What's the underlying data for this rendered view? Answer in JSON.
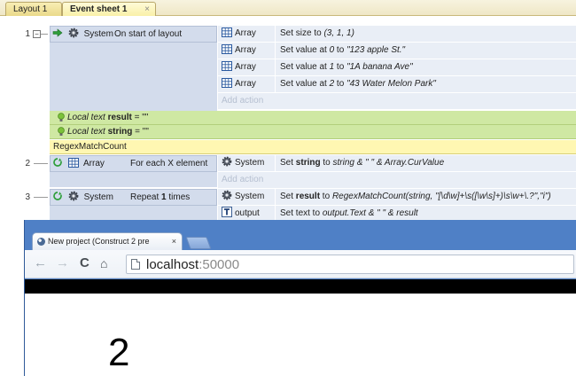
{
  "tabs": [
    {
      "label": "Layout 1"
    },
    {
      "label": "Event sheet 1",
      "close": "×"
    }
  ],
  "colors": {
    "condition_bg": "#d3dcec",
    "action_bg": "#e9eef6",
    "local_var_bg": "#cfe8a3",
    "comment_bg": "#fff7b2",
    "browser_frame": "#4f80c6"
  },
  "events": [
    {
      "number": "1",
      "condition": {
        "object": "System",
        "object_icon": "gear-icon",
        "text": "On start of layout"
      },
      "actions": [
        {
          "object": "Array",
          "icon": "grid-icon",
          "parts": [
            "Set size to ",
            "(3, 1, 1)"
          ]
        },
        {
          "object": "Array",
          "icon": "grid-icon",
          "parts": [
            "Set value at ",
            "0",
            " to ",
            "\"123 apple St.\""
          ]
        },
        {
          "object": "Array",
          "icon": "grid-icon",
          "parts": [
            "Set value at ",
            "1",
            " to ",
            "\"1A banana Ave\""
          ]
        },
        {
          "object": "Array",
          "icon": "grid-icon",
          "parts": [
            "Set value at ",
            "2",
            " to ",
            "\"43 Water Melon Park\""
          ]
        }
      ],
      "add_action": "Add action"
    },
    {
      "number": "2",
      "condition": {
        "object": "Array",
        "object_icon": "grid-icon",
        "text": "For each X element"
      },
      "actions": [
        {
          "object": "System",
          "icon": "gear-icon",
          "parts": [
            "Set ",
            "string",
            " to ",
            "string & \"  \" & Array.CurValue"
          ]
        }
      ],
      "add_action": "Add action"
    },
    {
      "number": "3",
      "condition": {
        "object": "System",
        "object_icon": "gear-icon",
        "text_prefix": "Repeat ",
        "text_bold": "1",
        "text_suffix": " times"
      },
      "actions": [
        {
          "object": "System",
          "icon": "gear-icon",
          "parts": [
            "Set ",
            "result",
            " to ",
            "RegexMatchCount(string, \"[\\d\\w]+\\s([\\w\\s]+)\\s\\w+\\.?\",\"i\")"
          ]
        },
        {
          "object": "output",
          "icon": "text-icon",
          "parts": [
            "Set text to ",
            "output.Text & \"     \" & result"
          ]
        }
      ]
    }
  ],
  "local_vars": [
    {
      "kind": "Local text",
      "name": "result",
      "value": "= \"\""
    },
    {
      "kind": "Local text",
      "name": "string",
      "value": "= \"\""
    }
  ],
  "comment": "RegexMatchCount",
  "browser": {
    "tab_title": "New project (Construct 2 pre",
    "tab_close": "×",
    "back": "←",
    "forward": "→",
    "reload": "C",
    "home": "⌂",
    "url_host": "localhost",
    "url_port": ":50000",
    "output_text": "2"
  }
}
